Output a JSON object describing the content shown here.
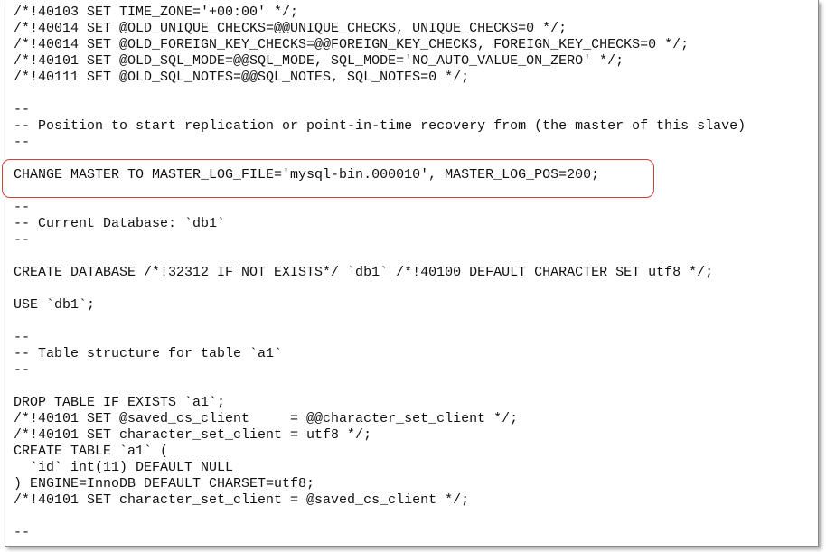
{
  "lines": [
    "/*!40103 SET TIME_ZONE='+00:00' */;",
    "/*!40014 SET @OLD_UNIQUE_CHECKS=@@UNIQUE_CHECKS, UNIQUE_CHECKS=0 */;",
    "/*!40014 SET @OLD_FOREIGN_KEY_CHECKS=@@FOREIGN_KEY_CHECKS, FOREIGN_KEY_CHECKS=0 */;",
    "/*!40101 SET @OLD_SQL_MODE=@@SQL_MODE, SQL_MODE='NO_AUTO_VALUE_ON_ZERO' */;",
    "/*!40111 SET @OLD_SQL_NOTES=@@SQL_NOTES, SQL_NOTES=0 */;",
    "",
    "--",
    "-- Position to start replication or point-in-time recovery from (the master of this slave)",
    "--",
    "",
    "CHANGE MASTER TO MASTER_LOG_FILE='mysql-bin.000010', MASTER_LOG_POS=200;",
    "",
    "--",
    "-- Current Database: `db1`",
    "--",
    "",
    "CREATE DATABASE /*!32312 IF NOT EXISTS*/ `db1` /*!40100 DEFAULT CHARACTER SET utf8 */;",
    "",
    "USE `db1`;",
    "",
    "--",
    "-- Table structure for table `a1`",
    "--",
    "",
    "DROP TABLE IF EXISTS `a1`;",
    "/*!40101 SET @saved_cs_client     = @@character_set_client */;",
    "/*!40101 SET character_set_client = utf8 */;",
    "CREATE TABLE `a1` (",
    "  `id` int(11) DEFAULT NULL",
    ") ENGINE=InnoDB DEFAULT CHARSET=utf8;",
    "/*!40101 SET character_set_client = @saved_cs_client */;",
    "",
    "--"
  ],
  "highlight_color": "#d0413a"
}
